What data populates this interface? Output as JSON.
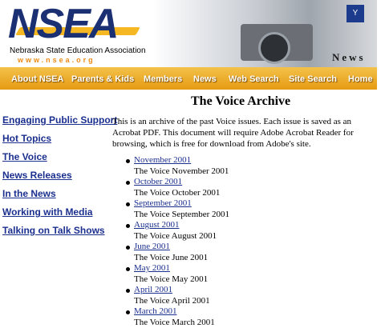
{
  "header": {
    "logo_text": "NSEA",
    "association_name": "Nebraska State Education Association",
    "url": "www.nsea.org",
    "section_label": "News",
    "badge_text": "Y"
  },
  "nav": {
    "items": [
      {
        "label": "About NSEA"
      },
      {
        "label": "Parents & Kids"
      },
      {
        "label": "Members"
      },
      {
        "label": "News"
      },
      {
        "label": "Web Search"
      },
      {
        "label": "Site Search"
      },
      {
        "label": "Home"
      }
    ]
  },
  "sidebar": {
    "links": [
      {
        "label": "Engaging Public Support"
      },
      {
        "label": "Hot Topics"
      },
      {
        "label": "The Voice"
      },
      {
        "label": "News Releases"
      },
      {
        "label": "In the News"
      },
      {
        "label": "Working with Media"
      },
      {
        "label": "Talking on Talk Shows"
      }
    ]
  },
  "main": {
    "title": "The Voice Archive",
    "intro": "This is an archive of the past Voice issues. Each issue is saved as an Acrobat PDF. This document will require Adobe Acrobat Reader for browsing, which is free for download from Adobe's site.",
    "issues": [
      {
        "link": "November 2001",
        "desc": "The Voice November 2001"
      },
      {
        "link": "October 2001",
        "desc": "The Voice October 2001"
      },
      {
        "link": "September 2001",
        "desc": "The Voice September 2001"
      },
      {
        "link": "August 2001",
        "desc": "The Voice August 2001"
      },
      {
        "link": "June 2001",
        "desc": "The Voice June 2001"
      },
      {
        "link": "May 2001",
        "desc": "The Voice May 2001"
      },
      {
        "link": "April 2001",
        "desc": "The Voice April 2001"
      },
      {
        "link": "March 2001",
        "desc": "The Voice March 2001"
      }
    ]
  },
  "colors": {
    "brand_blue": "#1b2f73",
    "brand_gold": "#f5b722",
    "link_blue": "#1b2f8f",
    "nav_orange": "#e69a12"
  }
}
